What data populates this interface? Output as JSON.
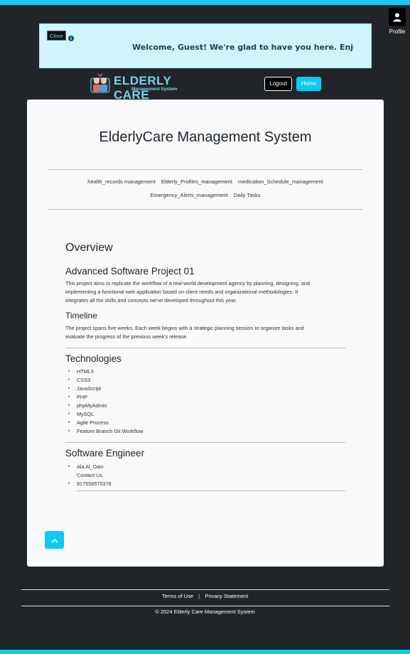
{
  "header": {
    "profile_label": "Profile",
    "banner": {
      "close_label": "Close",
      "welcome_text": "Welcome, Guest! We're glad to have you here. Enjoy using the so"
    },
    "logo": {
      "title": "ELDERLY CARE",
      "subtitle": "Management System"
    },
    "logout_label": "Logout",
    "home_label": "Home"
  },
  "main": {
    "title": "ElderlyCare Management System",
    "nav_links": [
      "health_records management",
      "Elderly_Profiles_management",
      "medication_Schedule_management",
      "Emergency_Alerts_management",
      "Daily Tasks"
    ],
    "overview_heading": "Overview",
    "project": {
      "heading": "Advanced Software Project 01",
      "lines": [
        "This project aims to replicate the workflow of a real-world development agency by planning, designing, and",
        "implementing a functional web application based on client needs and organizational methodologies. It",
        "integrates all the skills and concepts we've developed throughout this year."
      ]
    },
    "timeline": {
      "heading": "Timeline",
      "lines": [
        "The project spans five weeks. Each week begins with a strategic planning session to organize tasks and",
        "evaluate the progress of the previous week's release."
      ]
    },
    "technologies": {
      "heading": "Technologies",
      "items": [
        "HTML5",
        "CSS3",
        "JavaScript",
        "PHP",
        "phpMyAdmin",
        "MySQL",
        "Agile Process",
        "Feature Branch Git Workflow"
      ]
    },
    "engineer": {
      "heading": "Software Engineer",
      "name": "Ala Al_Dain",
      "contact": "Contact Us",
      "phone": "917558575378"
    }
  },
  "footer": {
    "terms": "Terms of Use",
    "separator": "|",
    "privacy": "Privacy Statement",
    "copyright": "© 2024 Elderly Care Management System"
  },
  "colors": {
    "page_bg": "#212529",
    "accent": "#0dcaf0",
    "banner_bg": "#cff4fc",
    "card_bg": "#f8f9fa"
  }
}
